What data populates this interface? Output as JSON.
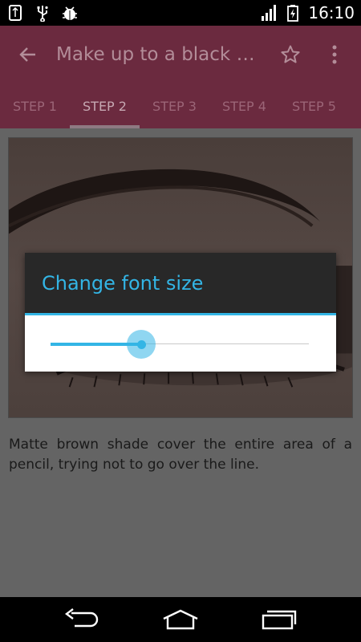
{
  "status_bar": {
    "time": "16:10",
    "left_icons": [
      "usb-storage-icon",
      "usb-icon",
      "android-debug-icon"
    ],
    "right_icons": [
      "signal-icon",
      "battery-charging-icon"
    ]
  },
  "toolbar": {
    "title": "Make up to a black d…",
    "back_icon": "arrow-back-icon",
    "star_icon": "star-outline-icon",
    "more_icon": "more-vert-icon"
  },
  "tabs": [
    {
      "label": "STEP 1",
      "active": false
    },
    {
      "label": "STEP 2",
      "active": true
    },
    {
      "label": "STEP 3",
      "active": false
    },
    {
      "label": "STEP 4",
      "active": false
    },
    {
      "label": "STEP 5",
      "active": false
    }
  ],
  "content": {
    "image": "eyebrow-makeup-photo",
    "description": "Matte brown shade cover the entire area of a pencil, trying not to go over the line."
  },
  "dialog": {
    "title": "Change font size",
    "slider_value_fraction": 0.35
  },
  "colors": {
    "accent": "#33b5e5",
    "app_bar": "#6b2a3f",
    "dialog_header": "#282828"
  },
  "nav_bar": {
    "buttons": [
      "back-icon",
      "home-icon",
      "recents-icon"
    ]
  }
}
